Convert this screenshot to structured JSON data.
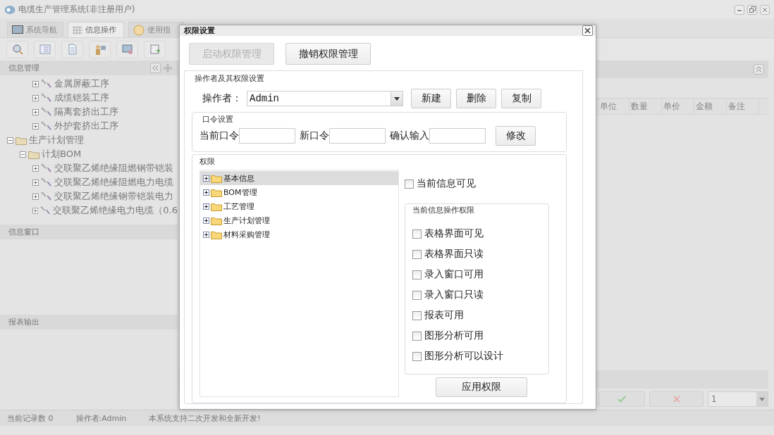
{
  "window": {
    "title": "电缆生产管理系统(非注册用户)"
  },
  "tabs": [
    {
      "label": "系统导航",
      "selected": false,
      "kind": "monitor"
    },
    {
      "label": "信息操作",
      "selected": true,
      "kind": "grid"
    },
    {
      "label": "使用指",
      "selected": false,
      "kind": "help"
    }
  ],
  "left_panel": {
    "title": "信息管理",
    "continued_items": [
      {
        "label": "金属屏蔽工序",
        "kind": "tool",
        "expanded": false
      },
      {
        "label": "成缆铠装工序",
        "kind": "tool",
        "expanded": false
      },
      {
        "label": "隔离套挤出工序",
        "kind": "tool",
        "expanded": false
      },
      {
        "label": "外护套挤出工序",
        "kind": "tool",
        "expanded": false
      }
    ],
    "items": [
      {
        "label": "生产计划管理",
        "kind": "folder",
        "expanded": true,
        "children": [
          {
            "label": "计划BOM",
            "kind": "folder",
            "expanded": true,
            "children": [
              {
                "label": "交联聚乙烯绝缘阻燃钢带铠装",
                "kind": "tool",
                "expanded": false
              },
              {
                "label": "交联聚乙烯绝缘阻燃电力电缆",
                "kind": "tool",
                "expanded": false
              },
              {
                "label": "交联聚乙烯绝缘钢带铠装电力",
                "kind": "tool",
                "expanded": false
              },
              {
                "label": "交联聚乙烯绝缘电力电缆（0.6",
                "kind": "tool",
                "expanded": false
              }
            ]
          }
        ]
      }
    ],
    "info_window_title": "信息窗口",
    "report_title": "报表输出"
  },
  "table": {
    "columns": [
      "单位",
      "数量",
      "单价",
      "金额",
      "备注"
    ]
  },
  "pager": {
    "value": "1"
  },
  "status_bar": [
    "当前记录数 0",
    "操作者:Admin",
    "本系统支持二次开发和全新开发!"
  ],
  "dialog": {
    "title": "权限设置",
    "buttons": [
      {
        "label": "启动权限管理",
        "disabled": true
      },
      {
        "label": "撤销权限管理",
        "disabled": false
      }
    ],
    "operator_section": {
      "legend": "操作者及其权限设置",
      "label": "操作者：",
      "value": "Admin",
      "actions": [
        "新建",
        "删除",
        "复制"
      ]
    },
    "password_section": {
      "legend": "口令设置",
      "fields": [
        "当前口令",
        "新口令",
        "确认输入"
      ],
      "button": "修改"
    },
    "permissions": {
      "legend": "权限",
      "tree": [
        {
          "label": "基本信息",
          "selected": true,
          "expanded": false
        },
        {
          "label": "BOM管理",
          "selected": false,
          "expanded": false
        },
        {
          "label": "工艺管理",
          "selected": false,
          "expanded": false
        },
        {
          "label": "生产计划管理",
          "selected": false,
          "expanded": false
        },
        {
          "label": "材料采购管理",
          "selected": false,
          "expanded": false
        }
      ],
      "visible": {
        "label": "当前信息可见",
        "checked": false
      },
      "operations_legend": "当前信息操作权限",
      "operations": [
        {
          "label": "表格界面可见",
          "checked": false
        },
        {
          "label": "表格界面只读",
          "checked": false
        },
        {
          "label": "录入窗口可用",
          "checked": false
        },
        {
          "label": "录入窗口只读",
          "checked": false
        },
        {
          "label": "报表可用",
          "checked": false
        },
        {
          "label": "图形分析可用",
          "checked": false
        },
        {
          "label": "图形分析可以设计",
          "checked": false
        }
      ],
      "apply": "应用权限"
    }
  }
}
